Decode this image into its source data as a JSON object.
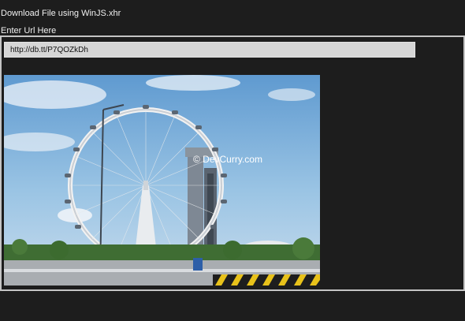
{
  "app": {
    "title": "Download File using WinJS.xhr"
  },
  "form": {
    "url_label": "Enter Url Here",
    "url_value": "http://db.tt/P7QOZkDh"
  },
  "image": {
    "watermark": "© DevCurry.com"
  }
}
